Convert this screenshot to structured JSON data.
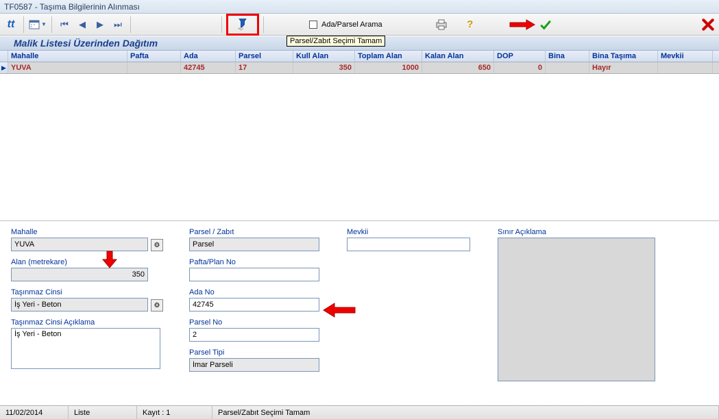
{
  "window": {
    "title": "TF0587 - Taşıma Bilgilerinin Alınması"
  },
  "toolbar": {
    "searchLabel": "Ada/Parsel Arama",
    "tooltip": "Parsel/Zabıt Seçimi Tamam"
  },
  "section": {
    "header": "Malik Listesi Üzerinden Dağıtım"
  },
  "grid": {
    "columns": {
      "mahalle": "Mahalle",
      "pafta": "Pafta",
      "ada": "Ada",
      "parsel": "Parsel",
      "kullalan": "Kull Alan",
      "toplam": "Toplam Alan",
      "kalan": "Kalan Alan",
      "dop": "DOP",
      "bina": "Bina",
      "binat": "Bina Taşıma",
      "mevkii": "Mevkii"
    },
    "row": {
      "mahalle": "YUVA",
      "pafta": "",
      "ada": "42745",
      "parsel": "17",
      "kullalan": "350",
      "toplam": "1000",
      "kalan": "650",
      "dop": "0",
      "bina": "",
      "binat": "Hayır",
      "mevkii": ""
    }
  },
  "form": {
    "mahalleLabel": "Mahalle",
    "mahalle": "YUVA",
    "alanLabel": "Alan (metrekare)",
    "alan": "350",
    "tcinsiLabel": "Taşınmaz Cinsi",
    "tcinsi": "İş Yeri - Beton",
    "tcinsiAcLabel": "Taşınmaz Cinsi Açıklama",
    "tcinsiAc": "İş Yeri - Beton",
    "parselZabitLabel": "Parsel / Zabıt",
    "parselZabit": "Parsel",
    "paftaNoLabel": "Pafta/Plan No",
    "paftaNo": "",
    "adaNoLabel": "Ada No",
    "adaNo": "42745",
    "parselNoLabel": "Parsel No",
    "parselNo": "2",
    "parselTipiLabel": "Parsel Tipi",
    "parselTipi": "İmar Parseli",
    "mevkiiLabel": "Mevkii",
    "mevkii": "",
    "sinirLabel": "Sınır Açıklama"
  },
  "status": {
    "date": "11/02/2014",
    "mode": "Liste",
    "kayit": "Kayıt : 1",
    "msg": "Parsel/Zabıt Seçimi Tamam"
  }
}
